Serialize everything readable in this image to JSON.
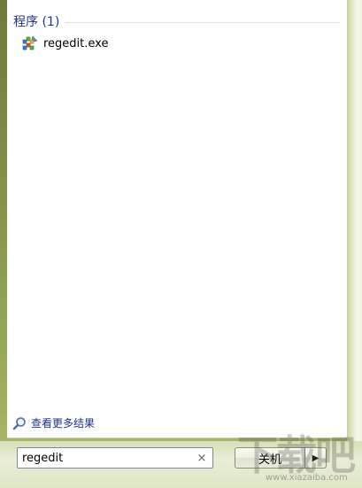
{
  "start_menu": {
    "section_title": "程序 (1)",
    "results": [
      {
        "label": "regedit.exe",
        "icon": "registry-editor-icon"
      }
    ],
    "see_more_label": "查看更多结果",
    "search": {
      "value": "regedit",
      "clear_glyph": "×"
    },
    "power_button_label": "关机",
    "power_arrow_glyph": "▶"
  },
  "watermark": {
    "text": "下载吧",
    "url": "www.xiazaiba.com"
  },
  "colors": {
    "link_blue": "#1e3287",
    "pane_background": "#ffffff",
    "wallpaper_green": "#8fa052"
  }
}
